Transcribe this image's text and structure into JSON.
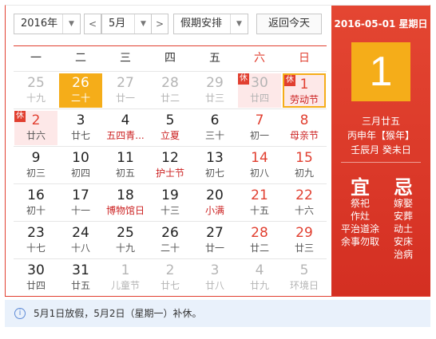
{
  "toolbar": {
    "year": "2016年",
    "month": "5月",
    "prev": "<",
    "next": ">",
    "holiday": "假期安排",
    "today_btn": "返回今天"
  },
  "weekdays": [
    "一",
    "二",
    "三",
    "四",
    "五",
    "六",
    "日"
  ],
  "weeks": [
    [
      {
        "num": "25",
        "lunar": "十九",
        "other": true
      },
      {
        "num": "26",
        "lunar": "二十",
        "today": true
      },
      {
        "num": "27",
        "lunar": "廿一",
        "other": true
      },
      {
        "num": "28",
        "lunar": "廿二",
        "other": true
      },
      {
        "num": "29",
        "lunar": "廿三",
        "other": true
      },
      {
        "num": "30",
        "lunar": "廿四",
        "other": true,
        "rest": true,
        "badge": "休"
      },
      {
        "num": "1",
        "lunar": "劳动节",
        "weekend": true,
        "festival": true,
        "rest": true,
        "badge": "休",
        "selected": true
      }
    ],
    [
      {
        "num": "2",
        "lunar": "廿六",
        "weekend": true,
        "rest": true,
        "badge": "休"
      },
      {
        "num": "3",
        "lunar": "廿七"
      },
      {
        "num": "4",
        "lunar": "五四青...",
        "festival": true
      },
      {
        "num": "5",
        "lunar": "立夏",
        "festival": true
      },
      {
        "num": "6",
        "lunar": "三十"
      },
      {
        "num": "7",
        "lunar": "初一",
        "weekend": true
      },
      {
        "num": "8",
        "lunar": "母亲节",
        "weekend": true,
        "festival": true
      }
    ],
    [
      {
        "num": "9",
        "lunar": "初三"
      },
      {
        "num": "10",
        "lunar": "初四"
      },
      {
        "num": "11",
        "lunar": "初五"
      },
      {
        "num": "12",
        "lunar": "护士节",
        "festival": true
      },
      {
        "num": "13",
        "lunar": "初七"
      },
      {
        "num": "14",
        "lunar": "初八",
        "weekend": true
      },
      {
        "num": "15",
        "lunar": "初九",
        "weekend": true
      }
    ],
    [
      {
        "num": "16",
        "lunar": "初十"
      },
      {
        "num": "17",
        "lunar": "十一"
      },
      {
        "num": "18",
        "lunar": "博物馆日",
        "festival": true
      },
      {
        "num": "19",
        "lunar": "十三"
      },
      {
        "num": "20",
        "lunar": "小满",
        "festival": true
      },
      {
        "num": "21",
        "lunar": "十五",
        "weekend": true
      },
      {
        "num": "22",
        "lunar": "十六",
        "weekend": true
      }
    ],
    [
      {
        "num": "23",
        "lunar": "十七"
      },
      {
        "num": "24",
        "lunar": "十八"
      },
      {
        "num": "25",
        "lunar": "十九"
      },
      {
        "num": "26",
        "lunar": "二十"
      },
      {
        "num": "27",
        "lunar": "廿一"
      },
      {
        "num": "28",
        "lunar": "廿二",
        "weekend": true
      },
      {
        "num": "29",
        "lunar": "廿三",
        "weekend": true
      }
    ],
    [
      {
        "num": "30",
        "lunar": "廿四"
      },
      {
        "num": "31",
        "lunar": "廿五"
      },
      {
        "num": "1",
        "lunar": "儿童节",
        "other": true
      },
      {
        "num": "2",
        "lunar": "廿七",
        "other": true
      },
      {
        "num": "3",
        "lunar": "廿八",
        "other": true
      },
      {
        "num": "4",
        "lunar": "廿九",
        "other": true
      },
      {
        "num": "5",
        "lunar": "环境日",
        "other": true
      }
    ]
  ],
  "side": {
    "date": "2016-05-01 星期日",
    "day": "1",
    "lunar": "三月廿五",
    "year_gz": "丙申年【猴年】",
    "month_day_gz": "壬辰月 癸未日",
    "yi": "宜",
    "ji": "忌",
    "yi_items": [
      "祭祀",
      "作灶",
      "平治道涂",
      "余事勿取"
    ],
    "ji_items": [
      "嫁娶",
      "安葬",
      "动土",
      "安床",
      "治病"
    ]
  },
  "notice": {
    "icon": "i",
    "text": "5月1日放假，5月2日（星期一）补休。"
  },
  "colors": {
    "accent": "#e13f30",
    "today": "#f5ad19",
    "notice_bg": "#e9f1fb"
  }
}
